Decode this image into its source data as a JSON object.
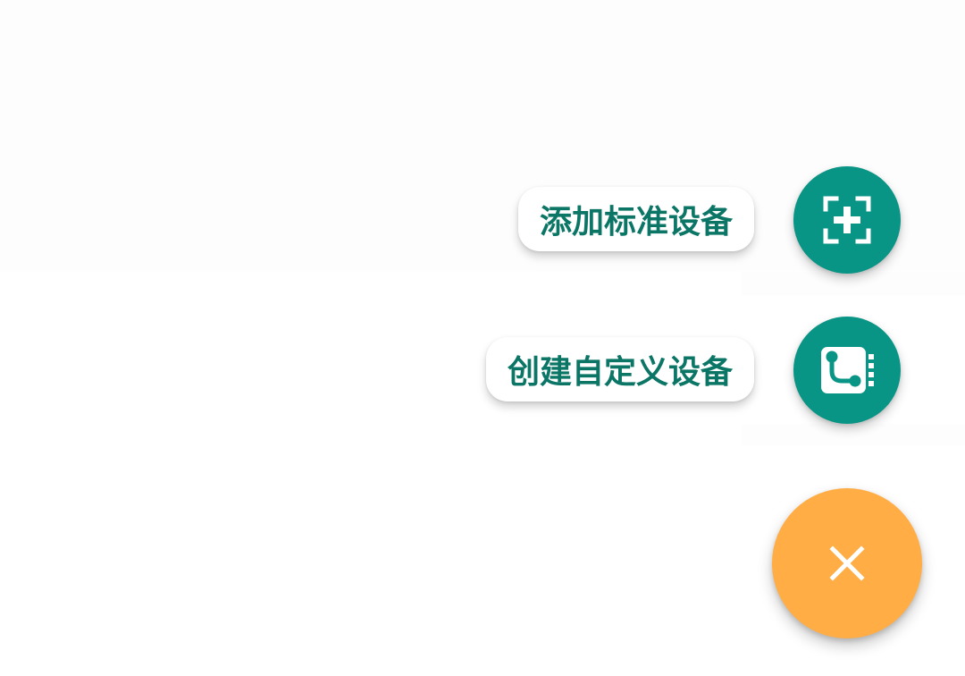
{
  "speed_dial": {
    "actions": [
      {
        "label": "添加标准设备",
        "icon": "scan-add-icon"
      },
      {
        "label": "创建自定义设备",
        "icon": "custom-device-icon"
      }
    ],
    "main_button": {
      "icon": "close-icon"
    }
  },
  "colors": {
    "action_fab": "#099585",
    "label_text": "#0b7566",
    "main_fab": "#ffad44",
    "icon": "#ffffff"
  }
}
